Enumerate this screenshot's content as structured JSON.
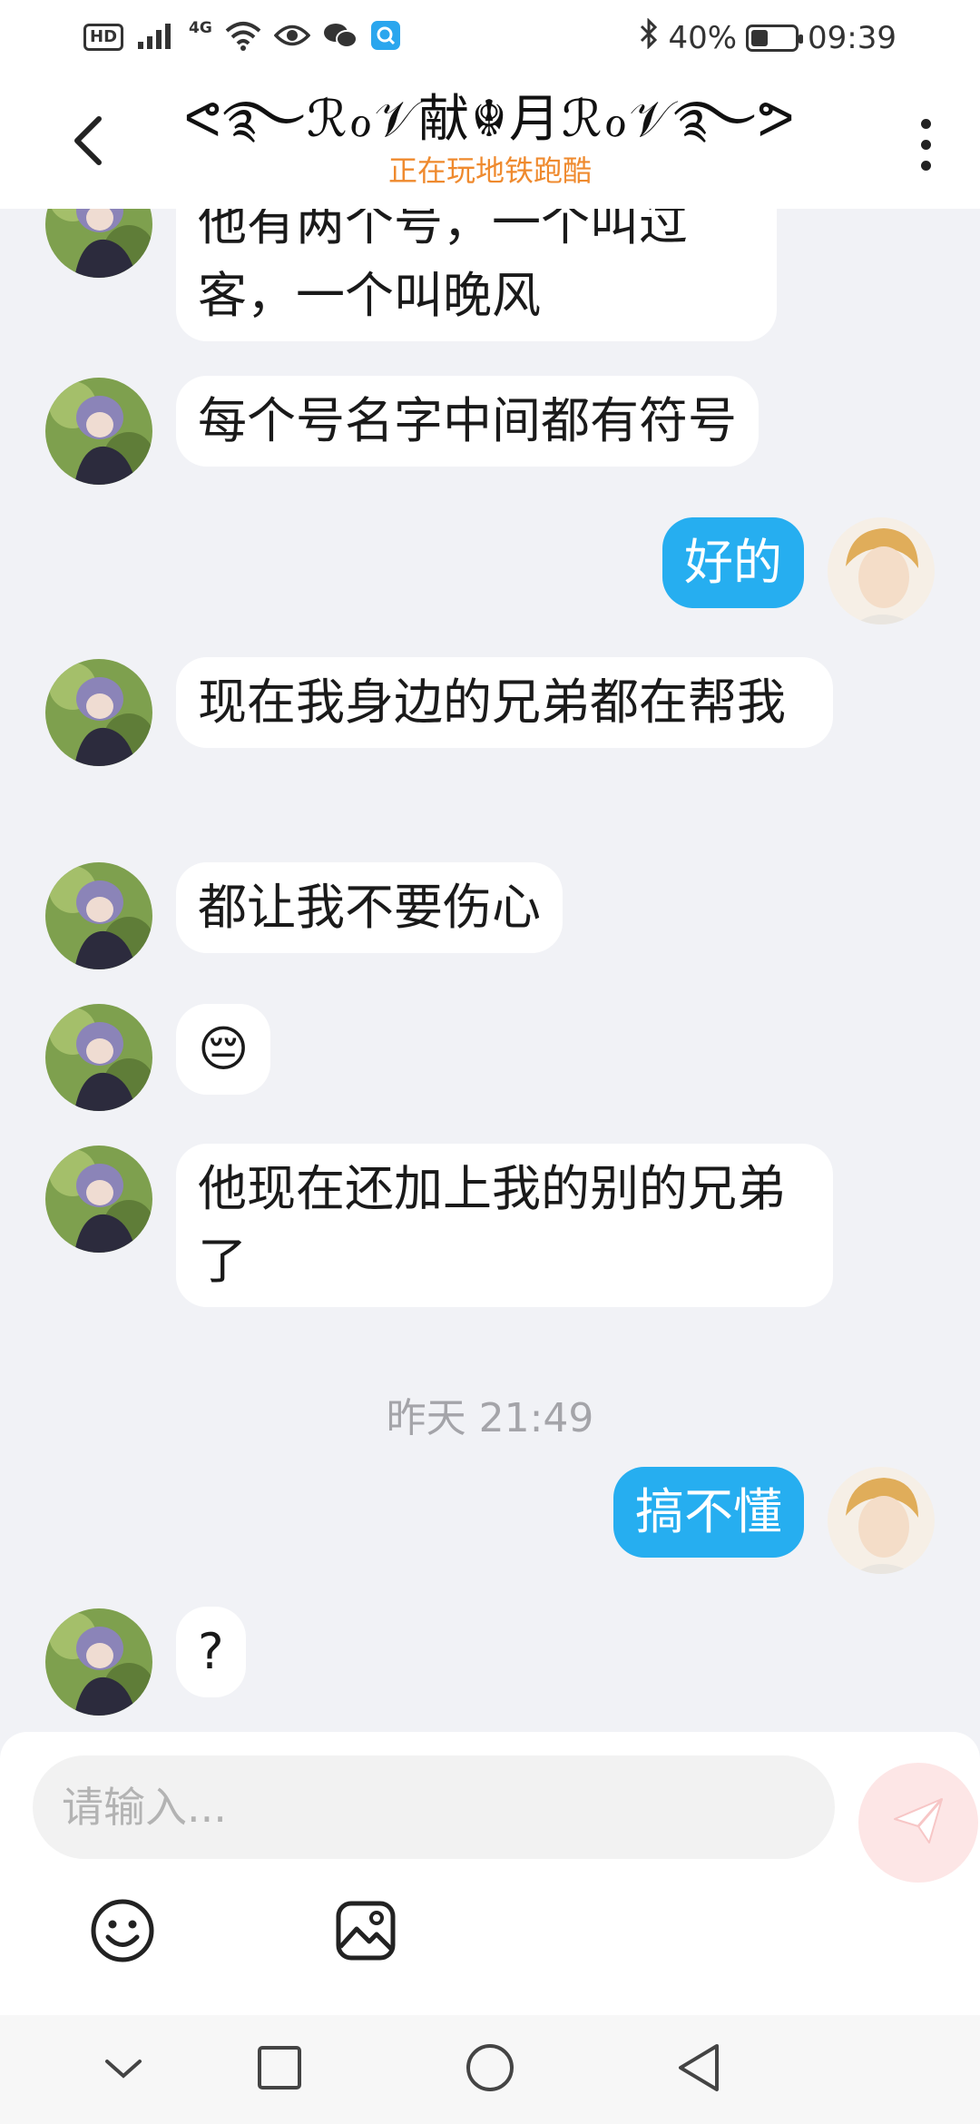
{
  "status_bar": {
    "hd": "HD",
    "network": "4G",
    "battery_text": "40%",
    "battery_level": 0.4,
    "time": "09:39"
  },
  "header": {
    "title": "ᕙ࿐ℛℴ𝒱献☬月ℛℴ𝒱࿐ᕗ",
    "subtitle": "正在玩地铁跑酷"
  },
  "messages": [
    {
      "sender": "other",
      "text": "他有两个号，一个叫过客，一个叫晚风"
    },
    {
      "sender": "other",
      "text": "每个号名字中间都有符号"
    },
    {
      "sender": "me",
      "text": "好的"
    },
    {
      "sender": "other",
      "text": "现在我身边的兄弟都在帮我"
    },
    {
      "sender": "other",
      "text": "都让我不要伤心"
    },
    {
      "sender": "other",
      "text": "😔"
    },
    {
      "sender": "other",
      "text": "他现在还加上我的别的兄弟了"
    },
    {
      "sender": "me",
      "text": "搞不懂"
    },
    {
      "sender": "other",
      "text": "?"
    }
  ],
  "timestamp": "昨天 21:49",
  "input": {
    "placeholder": "请输入..."
  },
  "icons": {
    "back": "chevron-left-icon",
    "more": "more-vertical-icon",
    "send": "paper-plane-icon",
    "emoji": "smiley-icon",
    "image": "image-icon"
  },
  "colors": {
    "outgoing_bubble": "#26aef0",
    "incoming_bubble": "#ffffff",
    "subtitle": "#ef8a2e",
    "background": "#f1f2f6"
  }
}
